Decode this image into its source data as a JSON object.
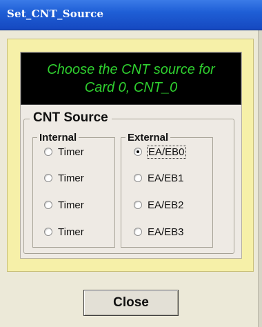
{
  "window": {
    "title": "Set_CNT_Source"
  },
  "display": {
    "line1": "Choose the CNT source for",
    "line2": "Card 0, CNT_0"
  },
  "cnt_source": {
    "label": "CNT Source",
    "internal": {
      "label": "Internal",
      "options": [
        {
          "label": "Timer",
          "checked": false
        },
        {
          "label": "Timer",
          "checked": false
        },
        {
          "label": "Timer",
          "checked": false
        },
        {
          "label": "Timer",
          "checked": false
        }
      ]
    },
    "external": {
      "label": "External",
      "options": [
        {
          "label": "EA/EB0",
          "checked": true
        },
        {
          "label": "EA/EB1",
          "checked": false
        },
        {
          "label": "EA/EB2",
          "checked": false
        },
        {
          "label": "EA/EB3",
          "checked": false
        }
      ]
    }
  },
  "close_button": {
    "label": "Close"
  },
  "colors": {
    "title_bar": "#1f5fd6",
    "panel_background": "#f6f0a8",
    "display_background": "#000000",
    "display_text": "#2fd12f",
    "window_background": "#ece9d8"
  }
}
